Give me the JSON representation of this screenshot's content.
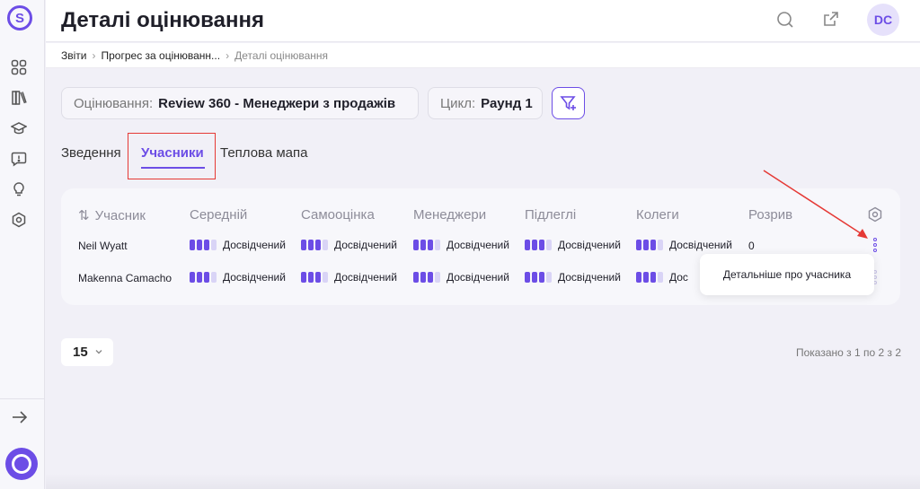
{
  "header": {
    "title": "Деталі оцінювання",
    "avatar_initials": "DC"
  },
  "breadcrumb": [
    "Звіти",
    "Прогрес за оцінюванн...",
    "Деталі оцінювання"
  ],
  "filters": {
    "assessment": {
      "label": "Оцінювання:",
      "value": "Review 360 - Менеджери з продажів"
    },
    "cycle": {
      "label": "Цикл:",
      "value": "Раунд 1"
    }
  },
  "tabs": [
    "Зведення",
    "Учасники",
    "Теплова мапа"
  ],
  "active_tab": "Учасники",
  "table": {
    "columns": [
      "Учасник",
      "Середній",
      "Самооцінка",
      "Менеджери",
      "Підлеглі",
      "Колеги",
      "Розрив"
    ],
    "rows": [
      {
        "name": "Neil Wyatt",
        "levels": [
          "Досвідчений",
          "Досвідчений",
          "Досвідчений",
          "Досвідчений",
          "Досвідчений"
        ],
        "gap": "0"
      },
      {
        "name": "Makenna Camacho",
        "levels": [
          "Досвідчений",
          "Досвідчений",
          "Досвідчений",
          "Досвідчений",
          "Дос"
        ],
        "gap": ""
      }
    ],
    "level_bars": {
      "filled": 3,
      "total": 4
    }
  },
  "row_menu": {
    "item": "Детальніше про учасника"
  },
  "pagination": {
    "page_size": "15",
    "showing": "Показано з 1 по 2 з 2"
  },
  "colors": {
    "accent": "#6c4de6",
    "annotation": "#e53935"
  },
  "icons": {
    "sidebar": [
      "grid-icon",
      "books-icon",
      "graduation-cap-icon",
      "feedback-icon",
      "lightbulb-icon",
      "settings-hex-icon"
    ],
    "header": [
      "search-icon",
      "open-external-icon"
    ]
  }
}
